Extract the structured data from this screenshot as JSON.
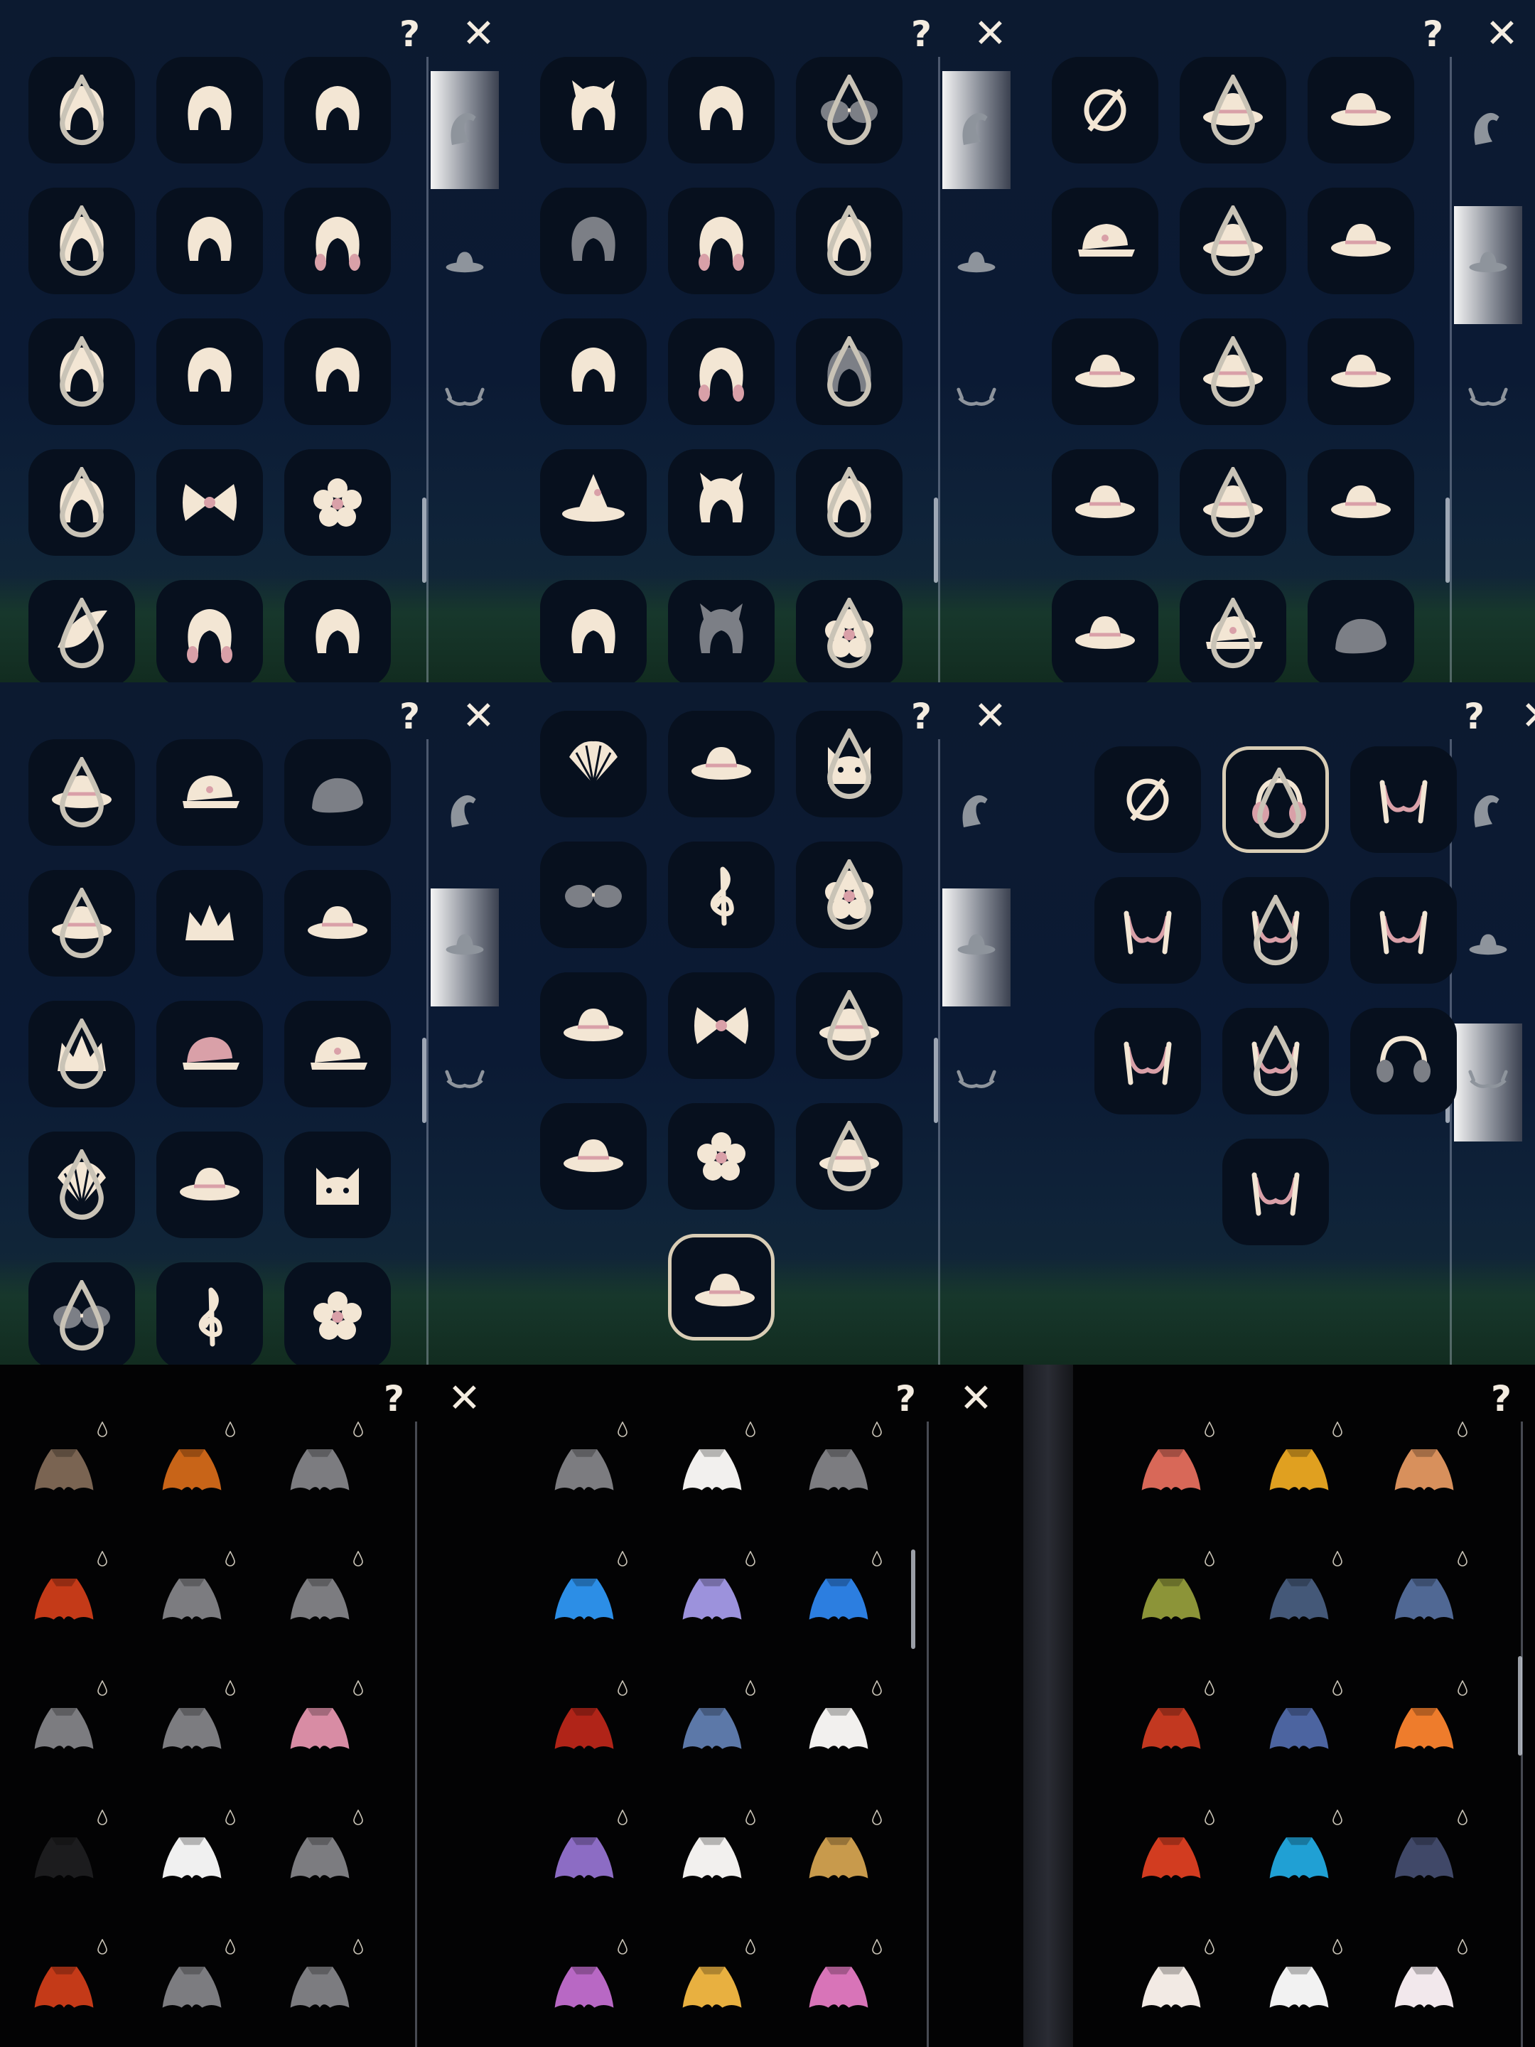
{
  "ui": {
    "help_label": "?",
    "close_label": "✕"
  },
  "colors": {
    "icon_cream": "#f3e6d4",
    "icon_pink": "#d9a0a8",
    "icon_gray": "#7c7f86",
    "slot_bg": "#07101e",
    "panel_bg": "#0c1a30"
  },
  "tabs": [
    {
      "name": "hair",
      "icon": "hair-icon"
    },
    {
      "name": "hat",
      "icon": "hat-icon"
    },
    {
      "name": "horns",
      "icon": "horns-icon"
    }
  ],
  "panels": [
    {
      "id": "hair-list-1",
      "active_tab": "hair",
      "items": [
        "long-hair-hook",
        "braided-hair",
        "bob-hair",
        "headband-hair",
        "wild-hair",
        "pink-scarf-hair",
        "spiky-headband-hair",
        "short-bob-hair",
        "side-ponytail-hair",
        "curly-top-hair",
        "bunny-bow-hair",
        "flower-pin-hair",
        "feather-hair",
        "twin-tail-hair",
        "round-bob-hair"
      ]
    },
    {
      "id": "hair-list-2",
      "active_tab": "hair",
      "items": [
        "cat-ear-hair",
        "bun-hair",
        "goggles-hair",
        "ram-horn-hair",
        "curly-long-hair",
        "space-bun-hair",
        "lion-dance-hair",
        "twin-ponytail-hair",
        "messy-gray-hair",
        "witch-hat",
        "fox-ear-hair",
        "wavy-long-hair",
        "beanie-hair",
        "bunny-ear-hair",
        "flower-bob-hair"
      ]
    },
    {
      "id": "hat-list-1",
      "active_tab": "hat",
      "items": [
        "none",
        "petal-hat",
        "pudding-hat",
        "flower-cap",
        "butterfly-hat",
        "explorer-hat",
        "pancake-hat",
        "cowboy-hat",
        "paper-boat-hat",
        "bow-hat",
        "goggles-hat",
        "feather-top-hat",
        "sun-hat-bow",
        "captain-cap",
        "rock-hat"
      ]
    },
    {
      "id": "hat-list-2",
      "active_tab": "hat",
      "items": [
        "sun-hat-bow",
        "captain-cap",
        "rock-hat",
        "apple-hat",
        "flower-crown",
        "antler-hat",
        "star-crown",
        "pink-cap",
        "white-cap",
        "shell-hat",
        "bonnet-hat",
        "cat-hat",
        "sunglasses",
        "treble-clef-pin",
        "flower-pin"
      ]
    },
    {
      "id": "hat-list-3",
      "active_tab": "hat",
      "items": [
        "shell-hat",
        "bonnet-hat",
        "cat-hat",
        "sunglasses",
        "treble-clef-pin",
        "flower-pin",
        "bird-hat",
        "bow-headband",
        "hood-hat",
        "heart-hat",
        "flower-vine",
        "fisherman-hat",
        "pink-blob-hat"
      ]
    },
    {
      "id": "horn-list",
      "active_tab": "horns",
      "items": [
        "none",
        "headphones-pink",
        "pink-earring",
        "moon-star-horns",
        "fang-horns",
        "tassel-horns",
        "bead-horns",
        "diamond-horns",
        "headphones-gray",
        "gear-horns"
      ]
    }
  ],
  "cape_panels": [
    {
      "id": "cape-list-1",
      "colors": [
        "#7a6452",
        "#c86418",
        "#7c7c80",
        "#c43a18",
        "#7c7c80",
        "#7c7c80",
        "#7c7c80",
        "#7c7c80",
        "#d88ca4",
        "#1c1c1e",
        "#f0f0f0",
        "#7c7c80",
        "#c43a18",
        "#7c7c80",
        "#7c7c80"
      ]
    },
    {
      "id": "cape-list-2",
      "colors": [
        "#7c7c80",
        "#f2f0ee",
        "#7c7c80",
        "#2c8ee6",
        "#9c92dc",
        "#2c7ee0",
        "#b02418",
        "#5c78a8",
        "#f2f0ee",
        "#8c6cc4",
        "#f2f0ee",
        "#c89a4c",
        "#b868c4",
        "#e8b040",
        "#d874b8"
      ]
    },
    {
      "id": "cape-list-3",
      "colors": [
        "#d86858",
        "#e0a020",
        "#d8905c",
        "#8c9438",
        "#445878",
        "#506894",
        "#c23820",
        "#4c64a0",
        "#ee7c2c",
        "#d23c20",
        "#20a0d4",
        "#404868",
        "#f2eae4",
        "#f2f2f2",
        "#f2e8ec"
      ]
    }
  ]
}
